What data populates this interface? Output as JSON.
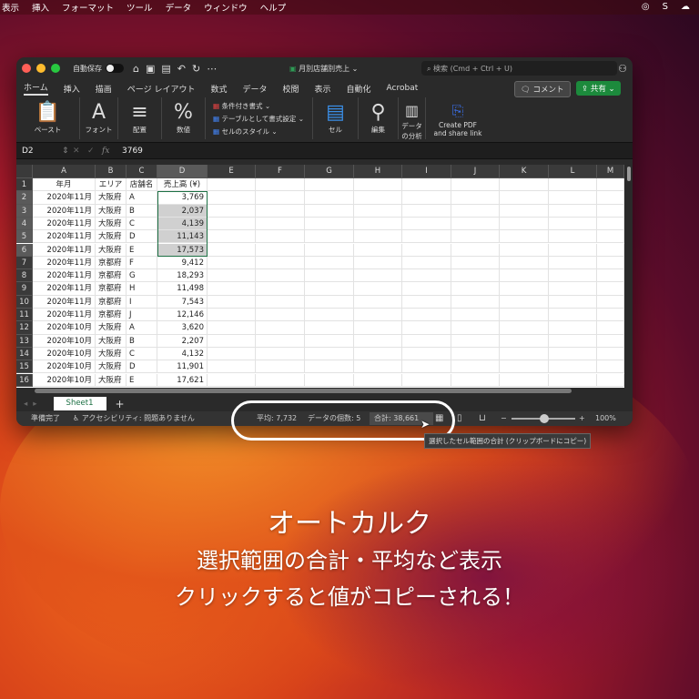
{
  "menubar": [
    "表示",
    "挿入",
    "フォーマット",
    "ツール",
    "データ",
    "ウィンドウ",
    "ヘルプ"
  ],
  "title": {
    "autosave": "自動保存",
    "filename": "月別店舗別売上",
    "search_placeholder": "検索 (Cmd + Ctrl + U)"
  },
  "tabs": [
    "ホーム",
    "挿入",
    "描画",
    "ページ レイアウト",
    "数式",
    "データ",
    "校閲",
    "表示",
    "自動化",
    "Acrobat"
  ],
  "comment_button": "コメント",
  "share_button": "共有",
  "ribbon": {
    "paste": "ペースト",
    "font": "フォント",
    "align": "配置",
    "number": "数値",
    "cond_format": "条件付き書式",
    "table_format": "テーブルとして書式設定",
    "cell_style": "セルのスタイル",
    "cell": "セル",
    "edit": "編集",
    "analyze": "データ\nの分析",
    "pdf": "Create PDF\nand share link"
  },
  "formula": {
    "name_box": "D2",
    "fx": "fx",
    "value": "3769"
  },
  "columns": [
    "A",
    "B",
    "C",
    "D",
    "E",
    "F",
    "G",
    "H",
    "I",
    "J",
    "K",
    "L",
    "M"
  ],
  "header_row": [
    "年月",
    "エリア",
    "店舗名",
    "売上高 (¥)"
  ],
  "rows": [
    [
      "2020年11月",
      "大阪府",
      "A",
      "3,769"
    ],
    [
      "2020年11月",
      "大阪府",
      "B",
      "2,037"
    ],
    [
      "2020年11月",
      "大阪府",
      "C",
      "4,139"
    ],
    [
      "2020年11月",
      "大阪府",
      "D",
      "11,143"
    ],
    [
      "2020年11月",
      "大阪府",
      "E",
      "17,573"
    ],
    [
      "2020年11月",
      "京都府",
      "F",
      "9,412"
    ],
    [
      "2020年11月",
      "京都府",
      "G",
      "18,293"
    ],
    [
      "2020年11月",
      "京都府",
      "H",
      "11,498"
    ],
    [
      "2020年11月",
      "京都府",
      "I",
      "7,543"
    ],
    [
      "2020年11月",
      "京都府",
      "J",
      "12,146"
    ],
    [
      "2020年10月",
      "大阪府",
      "A",
      "3,620"
    ],
    [
      "2020年10月",
      "大阪府",
      "B",
      "2,207"
    ],
    [
      "2020年10月",
      "大阪府",
      "C",
      "4,132"
    ],
    [
      "2020年10月",
      "大阪府",
      "D",
      "11,901"
    ],
    [
      "2020年10月",
      "大阪府",
      "E",
      "17,621"
    ]
  ],
  "sheet_tab": "Sheet1",
  "status": {
    "ready": "準備完了",
    "accessibility": "アクセシビリティ: 問題ありません",
    "average": "平均: 7,732",
    "count": "データの個数: 5",
    "sum": "合計: 38,661",
    "zoom": "100%",
    "zoom_percent": 100
  },
  "tooltip": "選択したセル範囲の合計 (クリップボードにコピー)",
  "caption": [
    "オートカルク",
    "選択範囲の合計・平均など表示",
    "クリックすると値がコピーされる！"
  ],
  "colors": {
    "accent": "#1e7145",
    "share": "#1c8a3c"
  }
}
